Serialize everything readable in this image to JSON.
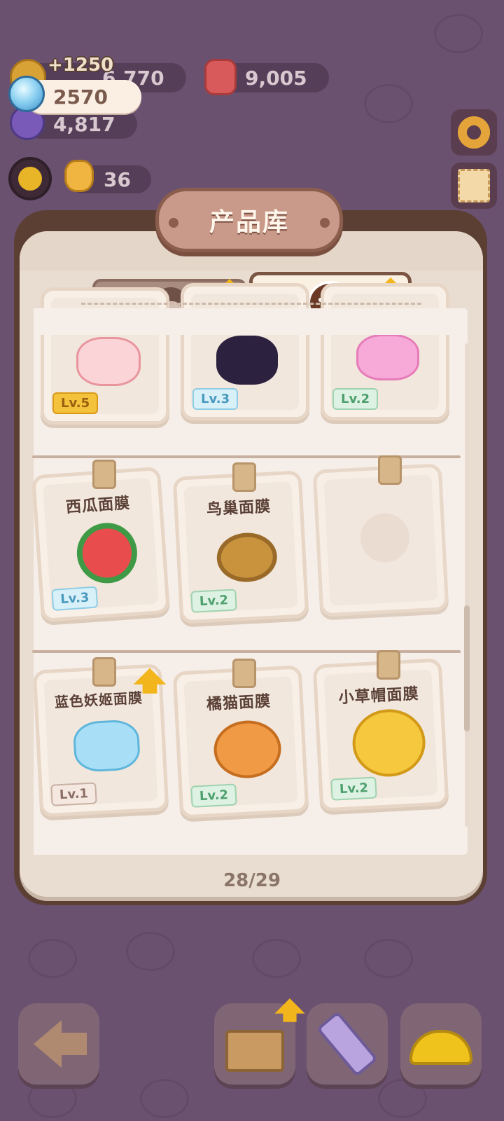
{
  "header": {
    "gain_label": "+1250",
    "bulb_value": "2570",
    "coin_value": "6,770",
    "gem_value": "9,005",
    "purple_value": "4,817",
    "duck_value": "36"
  },
  "panel": {
    "title": "产品库",
    "page_indicator": "28/29"
  },
  "tabs": [
    {
      "icon": "face-icon"
    },
    {
      "icon": "mask-icon"
    }
  ],
  "products": {
    "row0": [
      {
        "level": "Lv.5"
      },
      {
        "level": "Lv.3"
      },
      {
        "level": "Lv.2"
      }
    ],
    "row1": [
      {
        "name": "西瓜面膜",
        "level": "Lv.3"
      },
      {
        "name": "鸟巢面膜",
        "level": "Lv.2"
      },
      {
        "name": "",
        "level": ""
      }
    ],
    "row2": [
      {
        "name": "蓝色妖姬面膜",
        "level": "Lv.1"
      },
      {
        "name": "橘猫面膜",
        "level": "Lv.2"
      },
      {
        "name": "小草帽面膜",
        "level": "Lv.2"
      }
    ]
  },
  "colors": {
    "background": "#6b5170",
    "panel_frame": "#5c3f33",
    "panel_inner": "#e9ddd1",
    "accent_gold": "#f2b61c"
  }
}
